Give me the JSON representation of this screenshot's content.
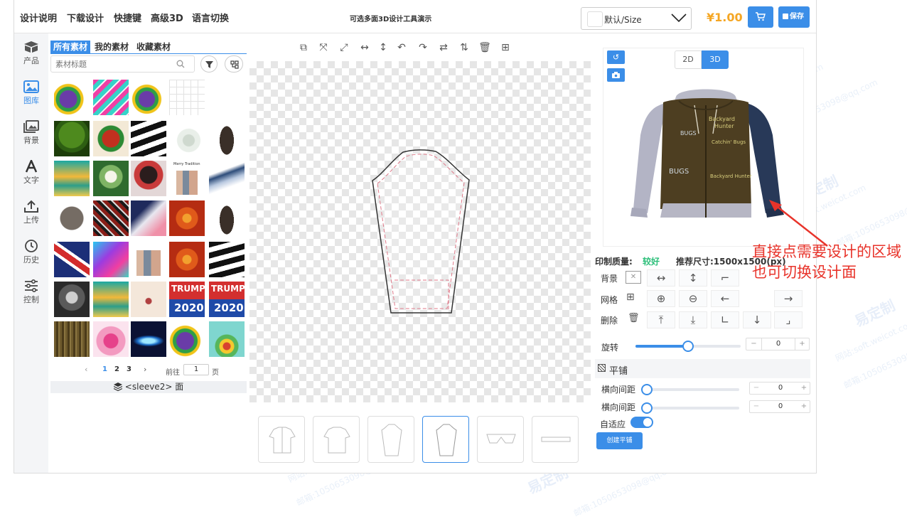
{
  "topbar": {
    "nav": [
      "设计说明",
      "下载设计",
      "快捷键",
      "高级3D",
      "语言切换"
    ],
    "center_title": "可选多面3D设计工具演示",
    "size_select": "默认/Size",
    "price": "¥1.00",
    "save_label": "保存"
  },
  "sidebar": {
    "items": [
      {
        "label": "产品",
        "icon": "box-icon"
      },
      {
        "label": "图库",
        "icon": "image-icon"
      },
      {
        "label": "背景",
        "icon": "images-icon"
      },
      {
        "label": "文字",
        "icon": "text-icon"
      },
      {
        "label": "上传",
        "icon": "upload-icon"
      },
      {
        "label": "历史",
        "icon": "clock-icon"
      },
      {
        "label": "控制",
        "icon": "sliders-icon"
      }
    ],
    "active": 1
  },
  "library": {
    "tabs": [
      "所有素材",
      "我的素材",
      "收藏素材"
    ],
    "search_placeholder": "素材标题",
    "thumb_texts": {
      "poster": "Merry Tradition",
      "trump": "TRUMP",
      "year": "2020"
    },
    "pagination": {
      "pages": [
        "1",
        "2",
        "3"
      ],
      "current": "1",
      "goto_prefix": "前往",
      "goto_value": "1",
      "goto_suffix": "页"
    },
    "face_label": "<sleeve2> 面"
  },
  "preview": {
    "tabs": [
      "2D",
      "3D"
    ],
    "active": "3D",
    "quality_label": "印制质量:",
    "quality_value": "较好",
    "size_label": "推荐尺寸:1500x1500(px)",
    "hoodie_texts": [
      "Backyard",
      "Hunter",
      "BUGS",
      "Catchin' Bugs",
      "BUGS",
      "Backyard Hunter"
    ]
  },
  "controls": {
    "background_label": "背景",
    "grid_label": "网格",
    "delete_label": "删除",
    "rotate_label": "旋转",
    "rotate_value": "0",
    "rotate_fraction": 0.5,
    "tile_label": "平铺",
    "h_spacing_label": "横向间距",
    "h_spacing_value": "0",
    "v_spacing_label": "横向间距",
    "v_spacing_value": "0",
    "auto_label": "自适应",
    "auto_on": true,
    "create_tile_button": "创建平铺"
  },
  "annotation": "直接点需要设计的区域也可切换设计面",
  "watermarks": {
    "brand": "易定制",
    "site": "网站:soft.weicot.com",
    "mail": "邮箱:1050653098@qq.com"
  },
  "colors": {
    "accent": "#3b8ee8",
    "price": "#f5a623",
    "annotation": "#e8332a",
    "quality_good": "#2dbf7a"
  }
}
